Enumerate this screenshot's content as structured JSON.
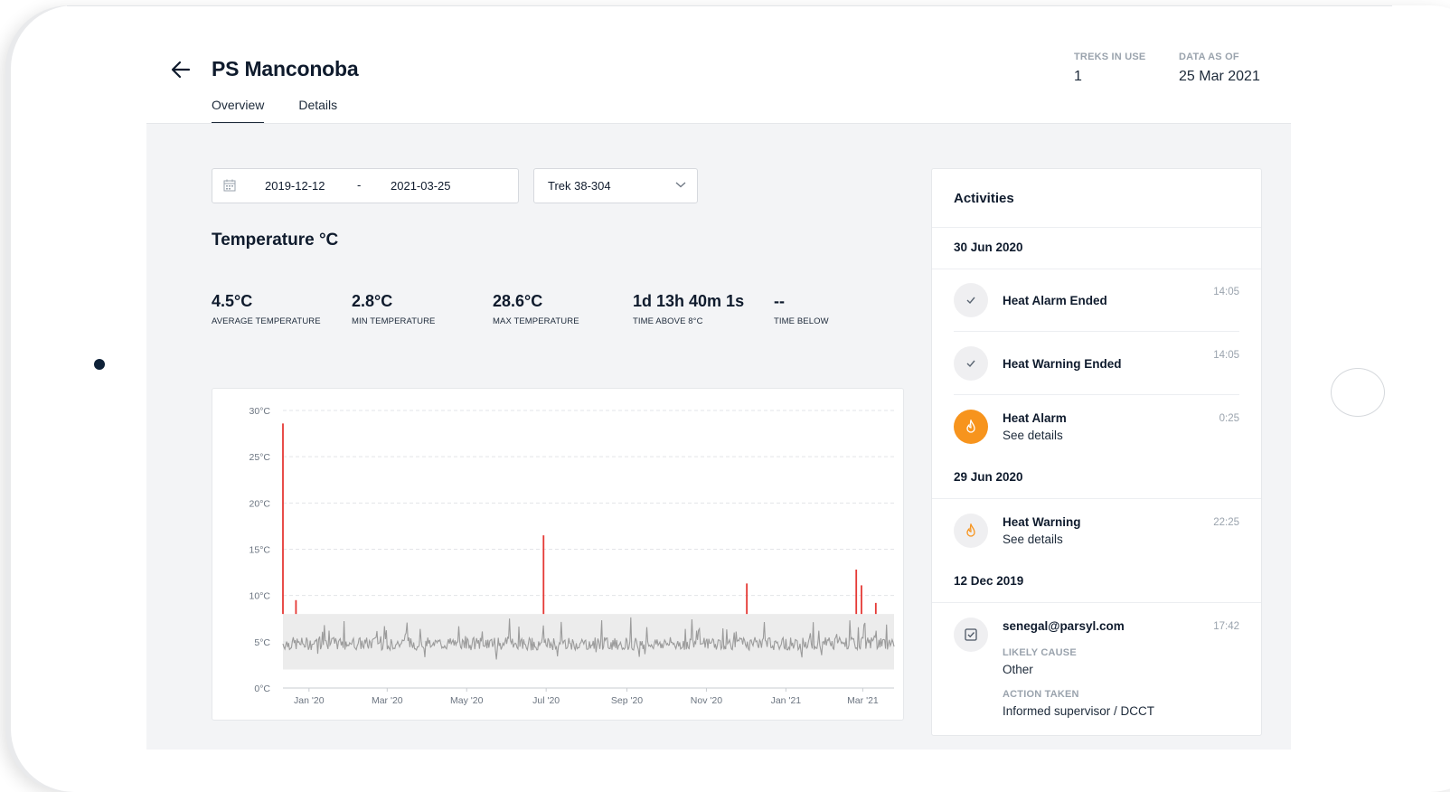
{
  "page": {
    "title": "PS Manconoba",
    "tabs": [
      "Overview",
      "Details"
    ],
    "treks_in_use": {
      "label": "TREKS IN USE",
      "value": "1"
    },
    "data_as_of": {
      "label": "DATA AS OF",
      "value": "25 Mar 2021"
    }
  },
  "filters": {
    "date_from": "2019-12-12",
    "date_separator": "-",
    "date_to": "2021-03-25",
    "trek_select": "Trek 38-304"
  },
  "temperature": {
    "title": "Temperature °C",
    "stats": [
      {
        "value": "4.5°C",
        "label": "AVERAGE TEMPERATURE"
      },
      {
        "value": "2.8°C",
        "label": "MIN TEMPERATURE"
      },
      {
        "value": "28.6°C",
        "label": "MAX TEMPERATURE"
      },
      {
        "value": "1d 13h 40m 1s",
        "label": "TIME ABOVE 8°C"
      },
      {
        "value": "--",
        "label": "TIME BELOW"
      }
    ]
  },
  "chart_data": {
    "type": "line",
    "title": "",
    "xlabel": "",
    "ylabel": "",
    "ylim": [
      0,
      30
    ],
    "y_ticks": [
      "0°C",
      "5°C",
      "10°C",
      "15°C",
      "20°C",
      "25°C",
      "30°C"
    ],
    "x_ticks": [
      "Jan '20",
      "Mar '20",
      "May '20",
      "Jul '20",
      "Sep '20",
      "Nov '20",
      "Jan '21",
      "Mar '21"
    ],
    "x_range": [
      "2019-12-12",
      "2021-03-25"
    ],
    "safe_band": [
      2,
      8
    ],
    "baseline_level": 4.8,
    "spikes": [
      {
        "date": "2019-12-12",
        "value": 28.6
      },
      {
        "date": "2019-12-22",
        "value": 9.5
      },
      {
        "date": "2020-06-29",
        "value": 16.5
      },
      {
        "date": "2020-12-02",
        "value": 11.3
      },
      {
        "date": "2021-02-24",
        "value": 12.8
      },
      {
        "date": "2021-02-28",
        "value": 11.1
      },
      {
        "date": "2021-03-11",
        "value": 9.2
      }
    ],
    "grid": true,
    "colors": {
      "normal": "#9b9b9b",
      "above": "#e53935",
      "band": "#ececec"
    }
  },
  "activities": {
    "title": "Activities",
    "groups": [
      {
        "date": "30 Jun 2020",
        "items": [
          {
            "title": "Heat Alarm Ended",
            "time": "14:05",
            "icon": "check-icon"
          },
          {
            "title": "Heat Warning Ended",
            "time": "14:05",
            "icon": "check-icon"
          },
          {
            "title": "Heat Alarm",
            "subtitle": "See details",
            "time": "0:25",
            "icon": "flame-icon"
          }
        ]
      },
      {
        "date": "29 Jun 2020",
        "items": [
          {
            "title": "Heat Warning",
            "subtitle": "See details",
            "time": "22:25",
            "icon": "flame-icon"
          }
        ]
      },
      {
        "date": "12 Dec 2019",
        "items": [
          {
            "title": "senegal@parsyl.com",
            "time": "17:42",
            "icon": "checkbox-icon",
            "likely_cause_label": "LIKELY CAUSE",
            "likely_cause": "Other",
            "action_label": "ACTION TAKEN",
            "action": "Informed supervisor / DCCT"
          }
        ]
      }
    ]
  },
  "colors": {
    "accent": "#f7941d",
    "alarm_red": "#e53935",
    "text": "#0f1b2d"
  }
}
